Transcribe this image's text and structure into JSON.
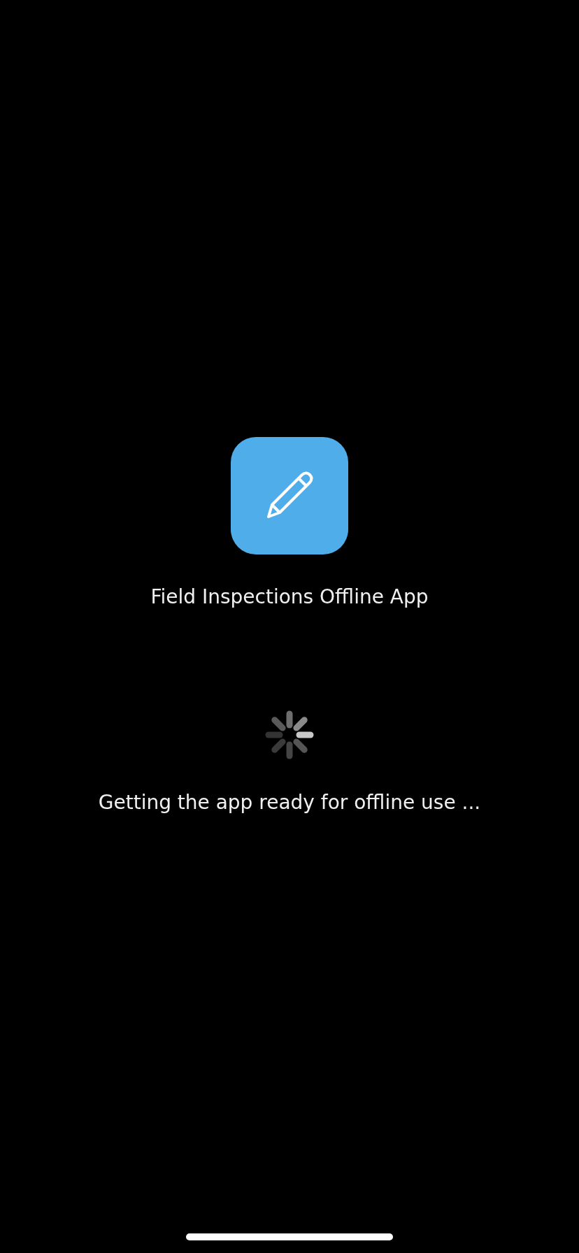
{
  "app": {
    "title": "Field Inspections Offline App"
  },
  "loading": {
    "message": "Getting the app ready for offline use ..."
  }
}
